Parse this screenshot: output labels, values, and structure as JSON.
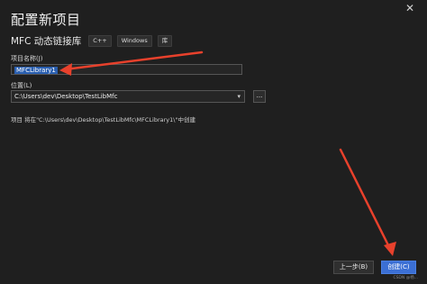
{
  "window": {
    "title": "配置新项目",
    "subtitle": "MFC 动态链接库",
    "tags": [
      "C++",
      "Windows",
      "库"
    ],
    "close_glyph": "✕"
  },
  "project_name": {
    "label": "项目名称(J)",
    "value": "MFCLibrary1"
  },
  "location": {
    "label": "位置(L)",
    "value": "C:\\Users\\dev\\Desktop\\TestLibMfc",
    "browse_label": "..."
  },
  "path_note": "项目 将在\"C:\\Users\\dev\\Desktop\\TestLibMfc\\MFCLibrary1\\\"中创建",
  "buttons": {
    "prev": "上一步(B)",
    "create": "创建(C)"
  },
  "watermark": "CSDN @杨...",
  "colors": {
    "accent": "#3b6fd4",
    "annotation_arrow": "#e8412c"
  }
}
